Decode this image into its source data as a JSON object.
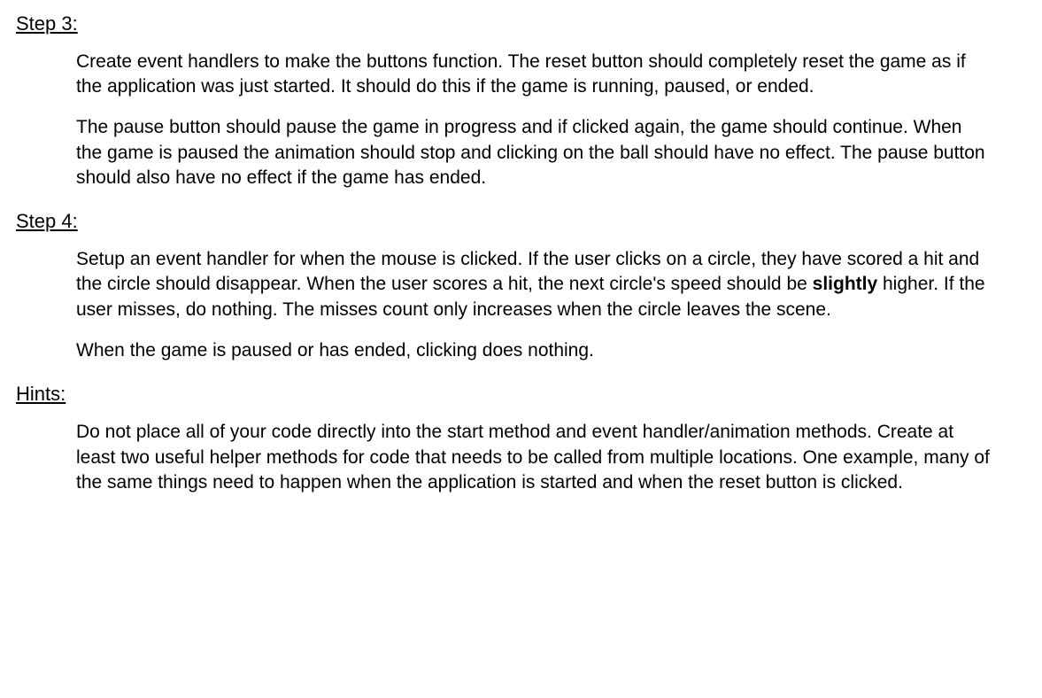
{
  "sections": [
    {
      "heading": "Step 3:",
      "paragraphs": [
        {
          "runs": [
            {
              "t": "Create event handlers to make the buttons function.  The reset button should completely reset the game as if the application was just started.  It should do this if the game is running, paused, or ended."
            }
          ]
        },
        {
          "runs": [
            {
              "t": "The pause button should pause the game in progress and if clicked again, the game should continue.  When the game is paused the animation should stop and clicking on the ball should have no effect.  The pause button should also have no effect if the game has ended."
            }
          ]
        }
      ]
    },
    {
      "heading": "Step 4:",
      "paragraphs": [
        {
          "runs": [
            {
              "t": "Setup an event handler for when the mouse is clicked.  If the user clicks on a circle, they have scored a hit and the circle should disappear.  When the user scores a hit, the next circle's speed should be "
            },
            {
              "t": "slightly",
              "bold": true
            },
            {
              "t": " higher.  If the user misses, do nothing.  The misses count only increases when the circle leaves the scene."
            }
          ]
        },
        {
          "runs": [
            {
              "t": "When the game is paused or has ended, clicking does nothing."
            }
          ]
        }
      ]
    },
    {
      "heading": "Hints:",
      "paragraphs": [
        {
          "runs": [
            {
              "t": "Do not place all of your code directly into the start method and event handler/animation methods.  Create at least two useful helper methods for code that needs to be called from multiple locations.  One example, many of the same things need to happen when the application is started and when the reset button is clicked."
            }
          ]
        }
      ]
    }
  ]
}
